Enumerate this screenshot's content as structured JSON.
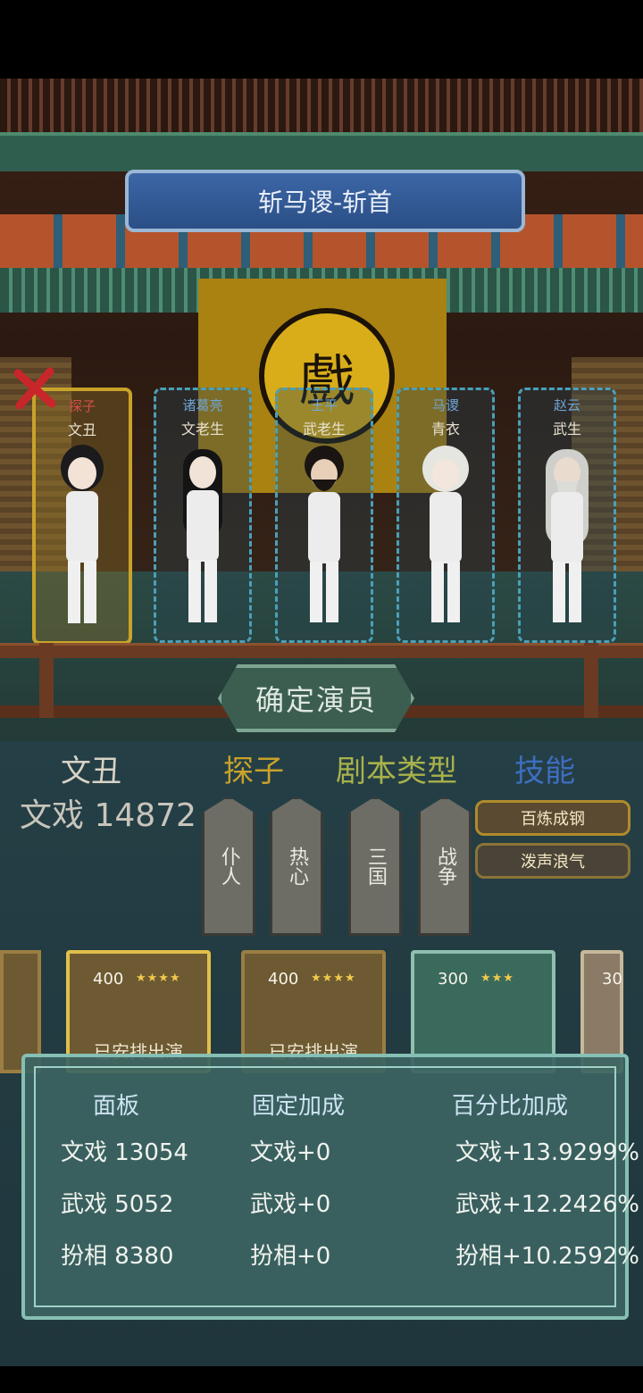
{
  "scene_title": "斩马谡-斩首",
  "stage_sign": "戲",
  "confirm_button": "确定演员",
  "actors": [
    {
      "role": "探子",
      "name": "文丑",
      "selected": true
    },
    {
      "role": "诸葛亮",
      "name": "文老生",
      "selected": false
    },
    {
      "role": "王平",
      "name": "武老生",
      "selected": false
    },
    {
      "role": "马谡",
      "name": "青衣",
      "selected": false
    },
    {
      "role": "赵云",
      "name": "武生",
      "selected": false
    }
  ],
  "info": {
    "role_type": "文丑",
    "role": "探子",
    "script_type_label": "剧本类型",
    "skill_label": "技能",
    "score": "文戏 14872"
  },
  "traits": [
    "仆人",
    "热心",
    "三国",
    "战争"
  ],
  "skills": [
    "百炼成钢",
    "泼声浪气"
  ],
  "cards": [
    {
      "cost": "400",
      "stars": "★★★★",
      "status": "已安排出演"
    },
    {
      "cost": "400",
      "stars": "★★★★",
      "status": "已安排出演"
    },
    {
      "cost": "300",
      "stars": "★★★",
      "status": ""
    },
    {
      "cost": "30",
      "stars": "",
      "status": ""
    }
  ],
  "stats": {
    "headers": [
      "面板",
      "固定加成",
      "百分比加成"
    ],
    "rows": [
      [
        "文戏 13054",
        "文戏+0",
        "文戏+13.9299%"
      ],
      [
        "武戏 5052",
        "武戏+0",
        "武戏+12.2426%"
      ],
      [
        "扮相 8380",
        "扮相+0",
        "扮相+10.2592%"
      ]
    ]
  },
  "colors": {
    "role_gold": "#c9a22a",
    "skill_blue": "#3d6fc0",
    "script_green": "#a8b24a"
  }
}
